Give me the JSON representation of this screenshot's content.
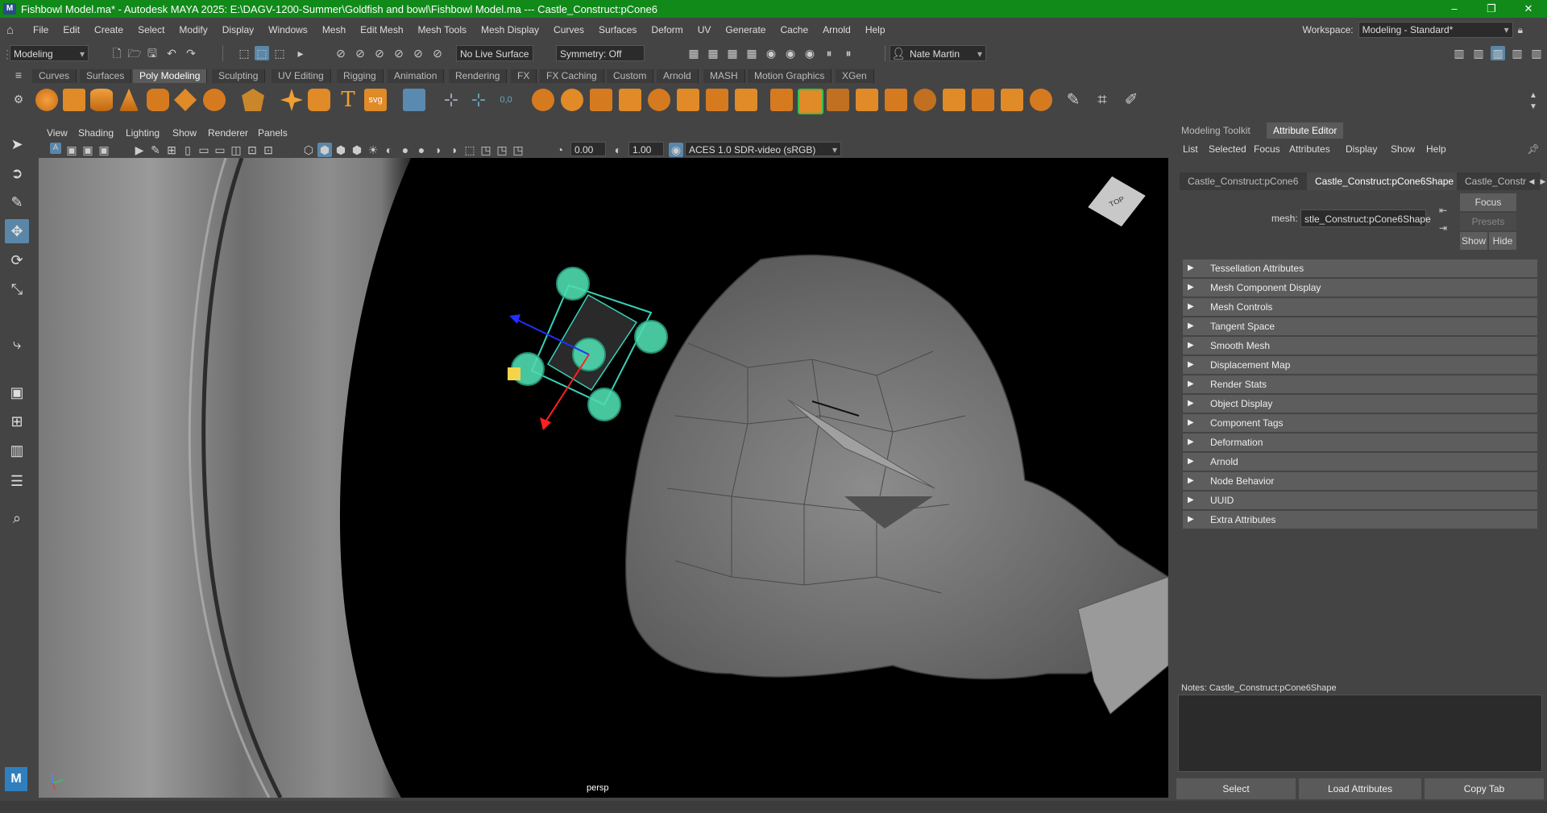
{
  "window": {
    "title": "Fishbowl Model.ma* - Autodesk MAYA 2025: E:\\DAGV-1200-Summer\\Goldfish and bowl\\Fishbowl Model.ma   ---   Castle_Construct:pCone6",
    "controls": [
      "–",
      "❐",
      "✕"
    ]
  },
  "menubar": {
    "items": [
      "File",
      "Edit",
      "Create",
      "Select",
      "Modify",
      "Display",
      "Windows",
      "Mesh",
      "Edit Mesh",
      "Mesh Tools",
      "Mesh Display",
      "Curves",
      "Surfaces",
      "Deform",
      "UV",
      "Generate",
      "Cache",
      "Arnold",
      "Help"
    ],
    "workspace_label": "Workspace:",
    "workspace_value": "Modeling - Standard*"
  },
  "statusline": {
    "mode": "Modeling",
    "live_surface": "No Live Surface",
    "symmetry": "Symmetry: Off",
    "user": "Nate Martin"
  },
  "shelf": {
    "tabs": [
      "Curves",
      "Surfaces",
      "Poly Modeling",
      "Sculpting",
      "UV Editing",
      "Rigging",
      "Animation",
      "Rendering",
      "FX",
      "FX Caching",
      "Custom",
      "Arnold",
      "MASH",
      "Motion Graphics",
      "XGen"
    ],
    "active_tab": "Poly Modeling",
    "svg_label": "svg",
    "text_label": "T"
  },
  "viewport": {
    "menus": [
      "View",
      "Shading",
      "Lighting",
      "Show",
      "Renderer",
      "Panels"
    ],
    "exposure": "0.00",
    "gamma": "1.00",
    "color_space": "ACES 1.0 SDR-video (sRGB)",
    "camera_label": "persp",
    "viewcube_label": "TOP"
  },
  "attribute_editor": {
    "panel_tabs": [
      "Modeling Toolkit",
      "Attribute Editor"
    ],
    "active_panel_tab": "Attribute Editor",
    "menus": [
      "List",
      "Selected",
      "Focus",
      "Attributes",
      "Display",
      "Show",
      "Help"
    ],
    "node_tabs": [
      "Castle_Construct:pCone6",
      "Castle_Construct:pCone6Shape",
      "Castle_Constr"
    ],
    "active_node_tab": "Castle_Construct:pCone6Shape",
    "mesh_label": "mesh:",
    "mesh_value": "stle_Construct:pCone6Shape",
    "focus_button": "Focus",
    "presets_button": "Presets",
    "show_button": "Show",
    "hide_button": "Hide",
    "sections": [
      "Tessellation Attributes",
      "Mesh Component Display",
      "Mesh Controls",
      "Tangent Space",
      "Smooth Mesh",
      "Displacement Map",
      "Render Stats",
      "Object Display",
      "Component Tags",
      "Deformation",
      "Arnold",
      "Node Behavior",
      "UUID",
      "Extra Attributes"
    ],
    "notes_label": "Notes:  Castle_Construct:pCone6Shape",
    "bottom_buttons": [
      "Select",
      "Load Attributes",
      "Copy Tab"
    ]
  }
}
